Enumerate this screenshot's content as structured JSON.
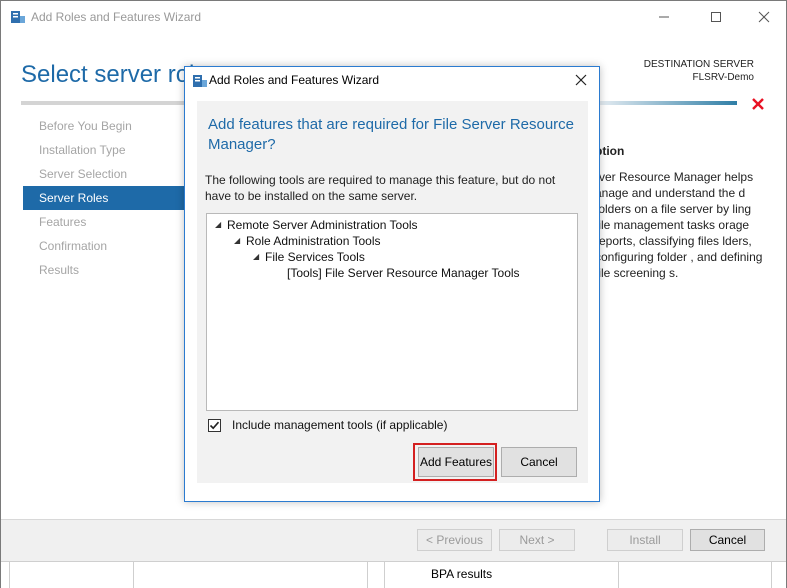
{
  "window": {
    "title": "Add Roles and Features Wizard",
    "page_title": "Select server roles",
    "destination_label": "DESTINATION SERVER",
    "destination_name": "FLSRV-Demo"
  },
  "nav": {
    "items": [
      {
        "label": "Before You Begin",
        "state": "inactive"
      },
      {
        "label": "Installation Type",
        "state": "inactive"
      },
      {
        "label": "Server Selection",
        "state": "inactive"
      },
      {
        "label": "Server Roles",
        "state": "active"
      },
      {
        "label": "Features",
        "state": "inactive"
      },
      {
        "label": "Confirmation",
        "state": "inactive"
      },
      {
        "label": "Results",
        "state": "inactive"
      }
    ]
  },
  "description": {
    "heading": "ption",
    "text": "rver Resource Manager helps anage and understand the d folders on a file server by ling file management tasks orage reports, classifying files lders, configuring folder , and defining file screening s."
  },
  "footer": {
    "previous": "< Previous",
    "next": "Next >",
    "install": "Install",
    "cancel": "Cancel",
    "bpa": "BPA results"
  },
  "dialog": {
    "title": "Add Roles and Features Wizard",
    "heading": "Add features that are required for File Server Resource Manager?",
    "info": "The following tools are required to manage this feature, but do not have to be installed on the same server.",
    "tree": [
      {
        "label": "Remote Server Administration Tools",
        "expanded": true
      },
      {
        "label": "Role Administration Tools",
        "expanded": true
      },
      {
        "label": "File Services Tools",
        "expanded": true
      },
      {
        "label": "[Tools] File Server Resource Manager Tools",
        "expanded": false
      }
    ],
    "checkbox_label": "Include management tools (if applicable)",
    "checkbox_checked": true,
    "add_features": "Add Features",
    "cancel": "Cancel"
  },
  "colors": {
    "accent": "#1e6aa8",
    "highlight": "#d42020",
    "error": "#e81123"
  },
  "icons": [
    "server-manager-icon",
    "minimize-icon",
    "maximize-icon",
    "close-icon",
    "error-x-icon",
    "collapse-triangle-icon",
    "checkmark-icon"
  ]
}
